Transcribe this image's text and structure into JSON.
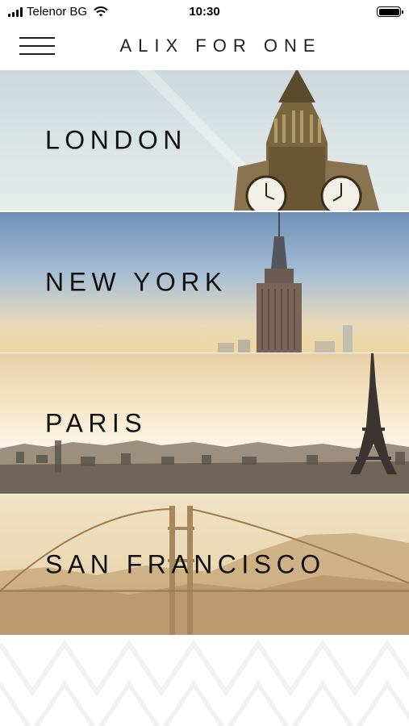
{
  "status_bar": {
    "carrier": "Telenor BG",
    "time": "10:30",
    "icons": [
      "signal-icon",
      "wifi-icon",
      "battery-icon"
    ]
  },
  "header": {
    "title": "ALIX FOR ONE",
    "menu_icon": "hamburger-menu-icon"
  },
  "cities": [
    {
      "name": "LONDON"
    },
    {
      "name": "NEW YORK"
    },
    {
      "name": "PARIS"
    },
    {
      "name": "SAN FRANCISCO"
    }
  ],
  "colors": {
    "text": "#111111",
    "background": "#ffffff"
  }
}
